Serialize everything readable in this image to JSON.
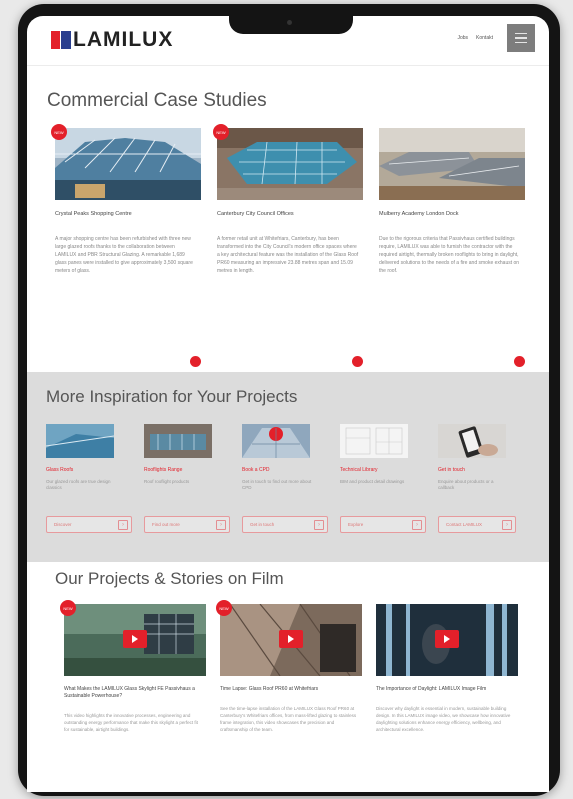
{
  "header": {
    "logo": "LAMILUX",
    "nav": [
      "Jobs",
      "Kontakt"
    ]
  },
  "commercial": {
    "title": "Commercial Case Studies",
    "items": [
      {
        "badge": "NEW",
        "title": "Crystal Peaks Shopping Centre",
        "text": "A major shopping centre has been refurbished with three new large glazed roofs thanks to the collaboration between LAMILUX and PBR Structural Glazing. A remarkable 1,689 glass panes were installed to give approximately 3,500 square meters of glass."
      },
      {
        "badge": "NEW",
        "title": "Canterbury City Council Offices",
        "text": "A former retail unit at Whitefriars, Canterbury, has been transformed into the City Council's modern office spaces where a key architectural feature was the installation of the Glass Roof PR60 measuring an impressive 23.88 metres span and 15.09 metres in length."
      },
      {
        "badge": "",
        "title": "Mulberry Academy London Dock",
        "text": "Due to the rigorous criteria that Passivhaus certified buildings require, LAMILUX was able to furnish the contractor with the required airtight, thermally broken rooflights to bring in daylight, delivered solutions to the needs of a fire and smoke exhaust on the roof."
      }
    ]
  },
  "inspiration": {
    "title": "More Inspiration for Your Projects",
    "items": [
      {
        "title": "Glass Roofs",
        "text": "Our glazed roofs are true design classics",
        "button": "Discover"
      },
      {
        "title": "Rooflights Range",
        "text": "Roof rooflight products",
        "button": "Find out more"
      },
      {
        "title": "Book a CPD",
        "text": "Get in touch to find out more about CPD",
        "button": "Get in touch"
      },
      {
        "title": "Technical Library",
        "text": "BIM and product detail drawings",
        "button": "Explore"
      },
      {
        "title": "Get in touch",
        "text": "Enquire about products or a callback",
        "button": "Contact LAMILUX"
      }
    ]
  },
  "films": {
    "title": "Our Projects & Stories on Film",
    "items": [
      {
        "badge": "NEW",
        "title": "What Makes the LAMILUX Glass Skylight FE Passivhaus a Sustainable Powerhouse?",
        "text": "This video highlights the innovative processes, engineering and outstanding energy performance that make this skylight a perfect fit for sustainable, airtight buildings."
      },
      {
        "badge": "NEW",
        "title": "Time Lapse: Glass Roof PR60 at Whitefriars",
        "text": "See the time-lapse installation of the LAMILUX Glass Roof PR60 at Canterbury's Whitefriars offices, from mass-lifted glazing to stainless frame integration, this video showcases the precision and craftsmanship of the team."
      },
      {
        "badge": "",
        "title": "The Importance of Daylight: LAMILUX Image Film",
        "text": "Discover why daylight is essential in modern, sustainable building design. In this LAMILUX image video, we showcase how innovative daylighting solutions enhance energy efficiency, wellbeing, and architectural excellence."
      }
    ]
  },
  "colors": {
    "accent": "#e3202a",
    "brand_blue": "#2a3f8f",
    "band": "#dcdcdc"
  }
}
